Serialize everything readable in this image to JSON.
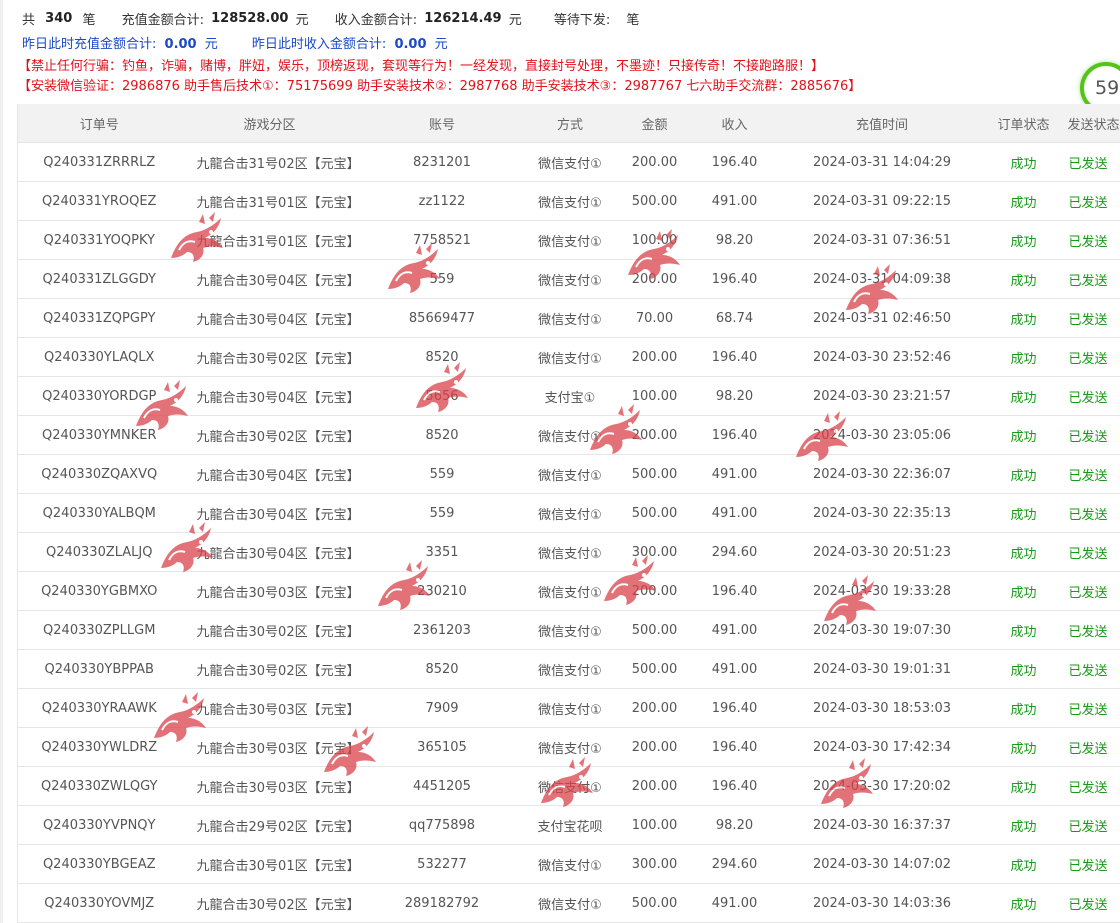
{
  "summary": {
    "total_label": "共",
    "total_count": "340",
    "total_unit": "笔",
    "recharge_label": "充值金额合计:",
    "recharge_total": "128528.00",
    "recharge_unit": "元",
    "income_label": "收入金额合计:",
    "income_total": "126214.49",
    "income_unit": "元",
    "pending_label": "等待下发:",
    "pending_unit": "笔"
  },
  "yesterday": {
    "recharge_label": "昨日此时充值金额合计:",
    "recharge_value": "0.00",
    "recharge_unit": "元",
    "income_label": "昨日此时收入金额合计:",
    "income_value": "0.00",
    "income_unit": "元"
  },
  "warnings": {
    "line1": "【禁止任何行骗：钓鱼，诈骗，赌博，胖妞，娱乐，顶榜返现，套现等行为！一经发现，直接封号处理，不墨迹！只接传奇！不接跑路服！】",
    "line2": "【安装微信验证：2986876 助手售后技术①：75175699 助手安装技术②：2987768 助手安装技术③：2987767 七六助手交流群：2885676】"
  },
  "badge": {
    "text": "59"
  },
  "colors": {
    "accent_blue": "#1a49c9",
    "warning_red": "#e0121b",
    "success_green": "#179a17",
    "watermark": "#d9434a"
  },
  "table": {
    "headers": [
      "订单号",
      "游戏分区",
      "账号",
      "方式",
      "金额",
      "收入",
      "充值时间",
      "订单状态",
      "发送状态"
    ],
    "rows": [
      [
        "Q240331ZRRRLZ",
        "九龍合击31号02区【元宝】",
        "8231201",
        "微信支付①",
        "200.00",
        "196.40",
        "2024-03-31 14:04:29",
        "成功",
        "已发送"
      ],
      [
        "Q240331YROQEZ",
        "九龍合击31号01区【元宝】",
        "zz1122",
        "微信支付①",
        "500.00",
        "491.00",
        "2024-03-31 09:22:15",
        "成功",
        "已发送"
      ],
      [
        "Q240331YOQPKY",
        "九龍合击31号01区【元宝】",
        "7758521",
        "微信支付①",
        "100.00",
        "98.20",
        "2024-03-31 07:36:51",
        "成功",
        "已发送"
      ],
      [
        "Q240331ZLGGDY",
        "九龍合击30号04区【元宝】",
        "559",
        "微信支付①",
        "200.00",
        "196.40",
        "2024-03-31 04:09:38",
        "成功",
        "已发送"
      ],
      [
        "Q240331ZQPGPY",
        "九龍合击30号04区【元宝】",
        "85669477",
        "微信支付①",
        "70.00",
        "68.74",
        "2024-03-31 02:46:50",
        "成功",
        "已发送"
      ],
      [
        "Q240330YLAQLX",
        "九龍合击30号02区【元宝】",
        "8520",
        "微信支付①",
        "200.00",
        "196.40",
        "2024-03-30 23:52:46",
        "成功",
        "已发送"
      ],
      [
        "Q240330YORDGP",
        "九龍合击30号04区【元宝】",
        "5656",
        "支付宝①",
        "100.00",
        "98.20",
        "2024-03-30 23:21:57",
        "成功",
        "已发送"
      ],
      [
        "Q240330YMNKER",
        "九龍合击30号02区【元宝】",
        "8520",
        "微信支付①",
        "200.00",
        "196.40",
        "2024-03-30 23:05:06",
        "成功",
        "已发送"
      ],
      [
        "Q240330ZQAXVQ",
        "九龍合击30号04区【元宝】",
        "559",
        "微信支付①",
        "500.00",
        "491.00",
        "2024-03-30 22:36:07",
        "成功",
        "已发送"
      ],
      [
        "Q240330YALBQM",
        "九龍合击30号04区【元宝】",
        "559",
        "微信支付①",
        "500.00",
        "491.00",
        "2024-03-30 22:35:13",
        "成功",
        "已发送"
      ],
      [
        "Q240330ZLALJQ",
        "九龍合击30号04区【元宝】",
        "3351",
        "微信支付①",
        "300.00",
        "294.60",
        "2024-03-30 20:51:23",
        "成功",
        "已发送"
      ],
      [
        "Q240330YGBMXO",
        "九龍合击30号03区【元宝】",
        "230210",
        "微信支付①",
        "200.00",
        "196.40",
        "2024-03-30 19:33:28",
        "成功",
        "已发送"
      ],
      [
        "Q240330ZPLLGM",
        "九龍合击30号02区【元宝】",
        "2361203",
        "微信支付①",
        "500.00",
        "491.00",
        "2024-03-30 19:07:30",
        "成功",
        "已发送"
      ],
      [
        "Q240330YBPPAB",
        "九龍合击30号02区【元宝】",
        "8520",
        "微信支付①",
        "500.00",
        "491.00",
        "2024-03-30 19:01:31",
        "成功",
        "已发送"
      ],
      [
        "Q240330YRAAWK",
        "九龍合击30号03区【元宝】",
        "7909",
        "微信支付①",
        "200.00",
        "196.40",
        "2024-03-30 18:53:03",
        "成功",
        "已发送"
      ],
      [
        "Q240330YWLDRZ",
        "九龍合击30号03区【元宝】",
        "365105",
        "微信支付①",
        "200.00",
        "196.40",
        "2024-03-30 17:42:34",
        "成功",
        "已发送"
      ],
      [
        "Q240330ZWLQGY",
        "九龍合击30号03区【元宝】",
        "4451205",
        "微信支付①",
        "200.00",
        "196.40",
        "2024-03-30 17:20:02",
        "成功",
        "已发送"
      ],
      [
        "Q240330YVPNQY",
        "九龍合击29号02区【元宝】",
        "qq775898",
        "支付宝花呗",
        "100.00",
        "98.20",
        "2024-03-30 16:37:37",
        "成功",
        "已发送"
      ],
      [
        "Q240330YBGEAZ",
        "九龍合击30号01区【元宝】",
        "532277",
        "微信支付①",
        "300.00",
        "294.60",
        "2024-03-30 14:07:02",
        "成功",
        "已发送"
      ],
      [
        "Q240330YOVMJZ",
        "九龍合击30号02区【元宝】",
        "289182792",
        "微信支付①",
        "500.00",
        "491.00",
        "2024-03-30 14:03:36",
        "成功",
        "已发送"
      ]
    ]
  },
  "watermark": {
    "icon": "dragon-watermark-icon"
  }
}
